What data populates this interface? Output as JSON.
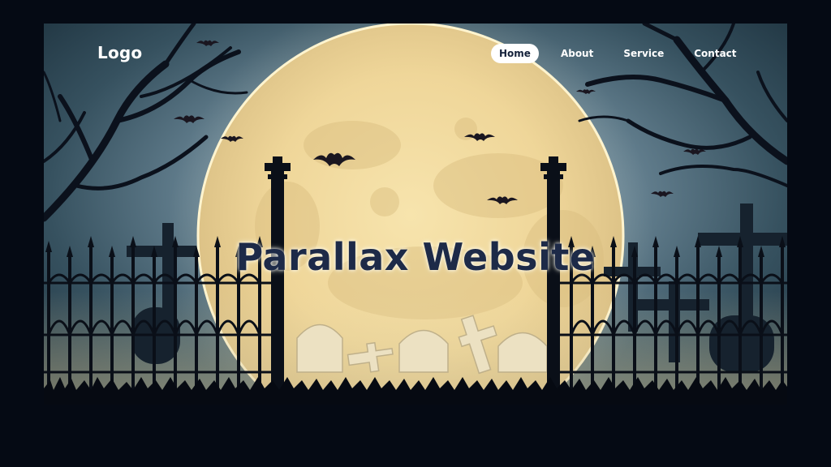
{
  "header": {
    "logo": "Logo",
    "nav": [
      {
        "label": "Home",
        "active": true
      },
      {
        "label": "About",
        "active": false
      },
      {
        "label": "Service",
        "active": false
      },
      {
        "label": "Contact",
        "active": false
      }
    ]
  },
  "hero": {
    "title": "Parallax Website"
  },
  "colors": {
    "sky": "#36515f",
    "moon": "#f3dfa6",
    "silhouette": "#0b111c",
    "title": "#1d2a48",
    "nav_active_bg": "#ffffff"
  }
}
